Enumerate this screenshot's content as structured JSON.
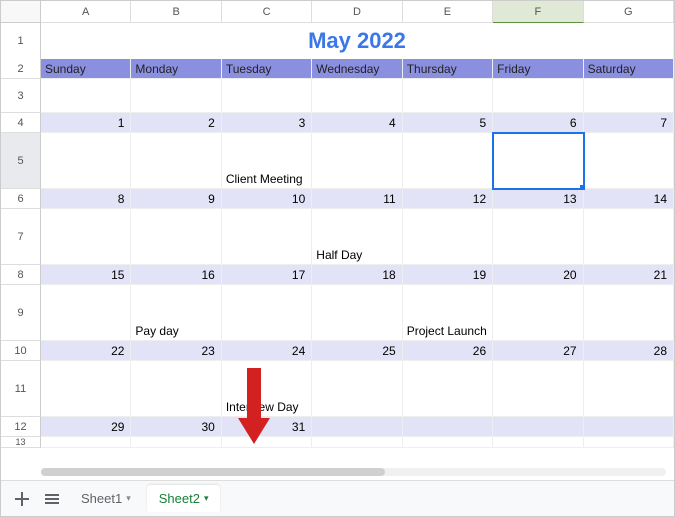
{
  "columns": [
    "A",
    "B",
    "C",
    "D",
    "E",
    "F",
    "G"
  ],
  "rows": [
    "1",
    "2",
    "3",
    "4",
    "5",
    "6",
    "7",
    "8",
    "9",
    "10",
    "11",
    "12",
    "13"
  ],
  "title": "May 2022",
  "daynames": [
    "Sunday",
    "Monday",
    "Tuesday",
    "Wednesday",
    "Thursday",
    "Friday",
    "Saturday"
  ],
  "weeks": [
    {
      "dates": [
        "",
        "",
        "",
        "",
        "",
        "",
        ""
      ],
      "events": [
        "",
        "",
        "",
        "",
        "",
        "",
        ""
      ]
    },
    {
      "dates": [
        "1",
        "2",
        "3",
        "4",
        "5",
        "6",
        "7"
      ],
      "events": [
        "",
        "",
        "Client Meeting",
        "",
        "",
        "",
        ""
      ]
    },
    {
      "dates": [
        "8",
        "9",
        "10",
        "11",
        "12",
        "13",
        "14"
      ],
      "events": [
        "",
        "",
        "",
        "Half Day",
        "",
        "",
        ""
      ]
    },
    {
      "dates": [
        "15",
        "16",
        "17",
        "18",
        "19",
        "20",
        "21"
      ],
      "events": [
        "",
        "Pay day",
        "",
        "",
        "Project Launch",
        "",
        ""
      ]
    },
    {
      "dates": [
        "22",
        "23",
        "24",
        "25",
        "26",
        "27",
        "28"
      ],
      "events": [
        "",
        "",
        "Interview Day",
        "",
        "",
        "",
        ""
      ]
    },
    {
      "dates": [
        "29",
        "30",
        "31",
        "",
        "",
        "",
        ""
      ],
      "events": [
        "",
        "",
        "",
        "",
        "",
        "",
        ""
      ]
    }
  ],
  "selected": {
    "col": "F",
    "row": "5"
  },
  "tabs": {
    "sheet1": "Sheet1",
    "sheet2": "Sheet2"
  }
}
